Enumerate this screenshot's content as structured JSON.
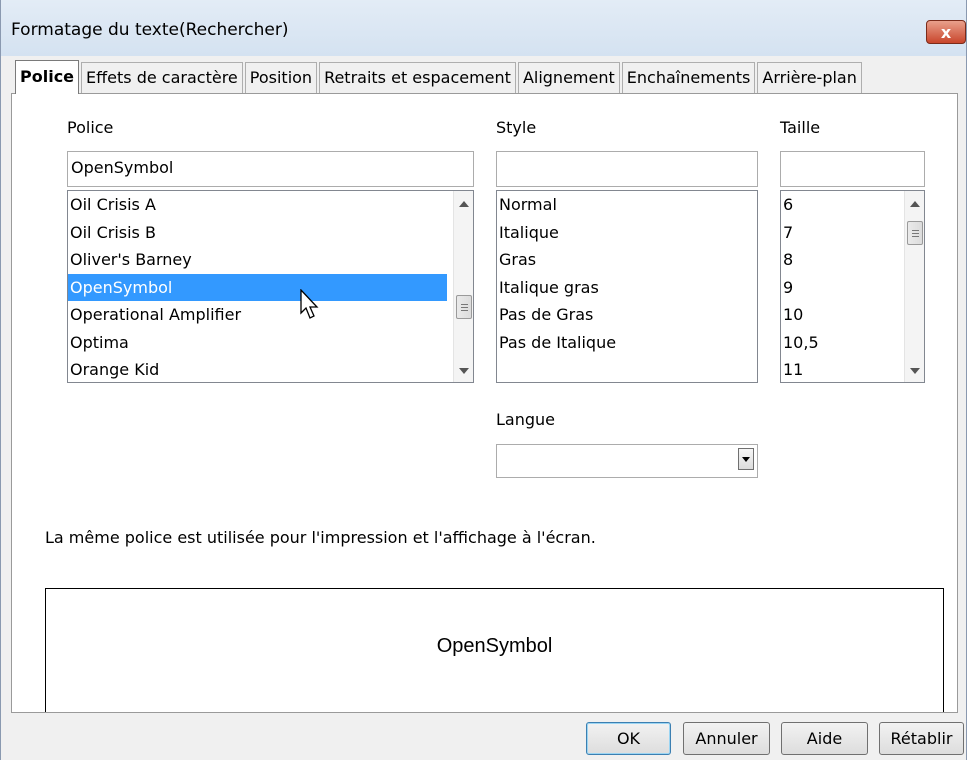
{
  "window": {
    "title": "Formatage du texte(Rechercher)",
    "close_label": "x"
  },
  "tabs": [
    {
      "label": "Police",
      "active": true
    },
    {
      "label": "Effets de caractère"
    },
    {
      "label": "Position"
    },
    {
      "label": "Retraits et espacement"
    },
    {
      "label": "Alignement"
    },
    {
      "label": "Enchaînements"
    },
    {
      "label": "Arrière-plan"
    }
  ],
  "font": {
    "label": "Police",
    "value": "OpenSymbol",
    "items": [
      "Oil Crisis A",
      "Oil Crisis B",
      "Oliver's Barney",
      "OpenSymbol",
      "Operational Amplifier",
      "Optima",
      "Orange Kid"
    ],
    "selected_index": 3
  },
  "style": {
    "label": "Style",
    "value": "",
    "items": [
      "Normal",
      "Italique",
      "Gras",
      "Italique gras",
      "Pas de Gras",
      "Pas de Italique"
    ]
  },
  "size": {
    "label": "Taille",
    "value": "",
    "items": [
      "6",
      "7",
      "8",
      "9",
      "10",
      "10,5",
      "11"
    ]
  },
  "language": {
    "label": "Langue",
    "value": ""
  },
  "info_text": "La même police est utilisée pour l'impression et l'affichage à l'écran.",
  "preview_text": "OpenSymbol",
  "buttons": {
    "ok": "OK",
    "cancel": "Annuler",
    "help": "Aide",
    "reset": "Rétablir"
  },
  "colors": {
    "selection": "#3399ff",
    "close_button": "#c9462c"
  }
}
